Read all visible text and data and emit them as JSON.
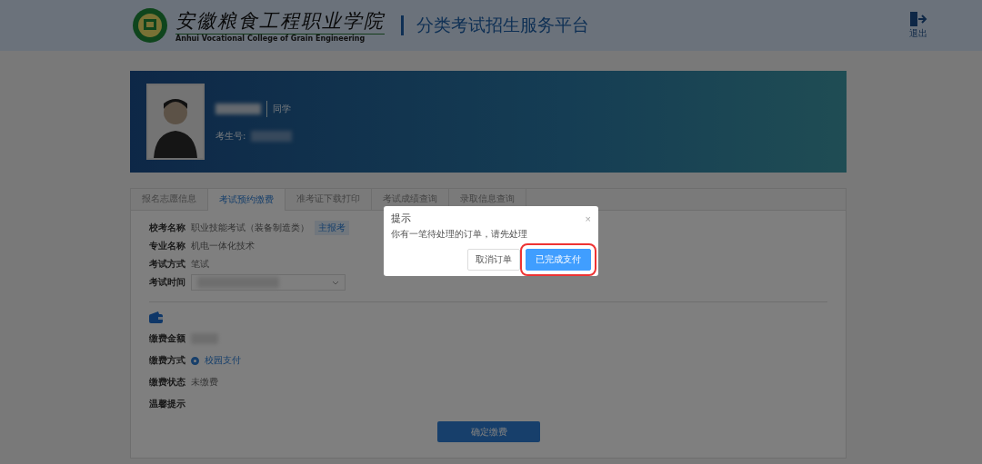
{
  "header": {
    "school_name": "安徽粮食工程职业学院",
    "school_name_en": "Anhui Vocational College of Grain Engineering",
    "platform": "分类考试招生服务平台",
    "logout": "退出"
  },
  "banner": {
    "suffix": "同学",
    "id_label": "考生号:"
  },
  "tabs": [
    {
      "label": "报名志愿信息",
      "selected": false
    },
    {
      "label": "考试预约缴费",
      "selected": true
    },
    {
      "label": "准考证下载打印",
      "selected": false
    },
    {
      "label": "考试成绩查询",
      "selected": false
    },
    {
      "label": "录取信息查询",
      "selected": false
    }
  ],
  "exam_fields": [
    {
      "kind": "text",
      "label": "校考名称",
      "value": "职业技能考试（装备制造类）",
      "tag": "主报考"
    },
    {
      "kind": "text",
      "label": "专业名称",
      "value": "机电一体化技术"
    },
    {
      "kind": "text",
      "label": "考试方式",
      "value": "笔试"
    },
    {
      "kind": "select",
      "label": "考试时间"
    }
  ],
  "payment_fields": [
    {
      "kind": "blurred",
      "label": "缴费金额"
    },
    {
      "kind": "radio",
      "label": "缴费方式",
      "value": "校园支付",
      "selected": true
    },
    {
      "kind": "text",
      "label": "缴费状态",
      "value": "未缴费"
    },
    {
      "kind": "text",
      "label": "温馨提示"
    }
  ],
  "confirm_button": "确定缴费",
  "dialog": {
    "title": "提示",
    "close": "×",
    "message": "你有一笔待处理的订单，请先处理",
    "buttons": [
      {
        "label": "取消订单",
        "kind": "plain",
        "highlighted": false
      },
      {
        "label": "已完成支付",
        "kind": "primary",
        "highlighted": true
      }
    ]
  }
}
